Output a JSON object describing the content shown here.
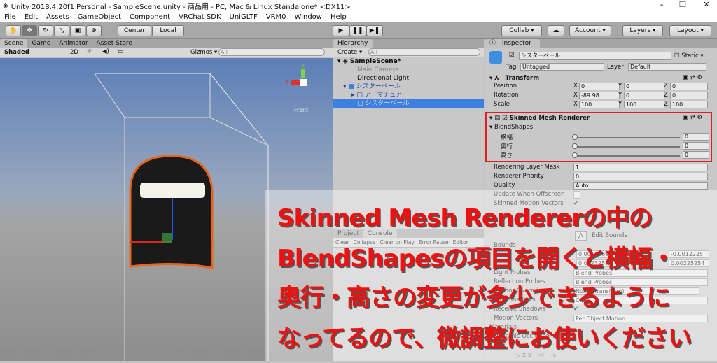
{
  "window": {
    "title": "Unity 2018.4.20f1 Personal - SampleScene.unity - 商品用 - PC, Mac & Linux Standalone* <DX11>",
    "min": "–",
    "max": "❐",
    "close": "✕"
  },
  "menu": [
    "File",
    "Edit",
    "Assets",
    "GameObject",
    "Component",
    "VRChat SDK",
    "UniGLTF",
    "VRM0",
    "Window",
    "Help"
  ],
  "toolbar": {
    "center": "Center",
    "local": "Local",
    "collab": "Collab ▾",
    "account": "Account ▾",
    "layers": "Layers ▾",
    "layout": "Layout ▾",
    "play": "▶",
    "pause": "❚❚",
    "step": "▶❚"
  },
  "scene": {
    "tabs": [
      "Scene",
      "Game",
      "Animator",
      "Asset Store"
    ],
    "shading": "Shaded",
    "mode2d": "2D",
    "gizmos": "Gizmos ▾",
    "search_placeholder": "All",
    "gizmo_label": "Front",
    "axis_x": "x",
    "axis_y": "y"
  },
  "hierarchy": {
    "tab": "Hierarchy",
    "create": "Create ▾",
    "search_placeholder": "All",
    "scene": "SampleScene*",
    "items": [
      "Main Camera",
      "Directional Light",
      "シスターベール",
      "アーマチュア",
      "シスターベール"
    ]
  },
  "console": {
    "tabs": [
      "Project",
      "Console"
    ],
    "buttons": [
      "Clear",
      "Collapse",
      "Clear on Play",
      "Error Pause",
      "Editor"
    ]
  },
  "inspector": {
    "tab": "Inspector",
    "object_name": "シスターベール",
    "static": "Static",
    "tag_label": "Tag",
    "tag": "Untagged",
    "layer_label": "Layer",
    "layer": "Default",
    "transform": {
      "title": "Transform",
      "rows": [
        {
          "label": "Position",
          "x": "0",
          "y": "0",
          "z": "0"
        },
        {
          "label": "Rotation",
          "x": "-89.98",
          "y": "0",
          "z": "0"
        },
        {
          "label": "Scale",
          "x": "100",
          "y": "100",
          "z": "100"
        }
      ]
    },
    "smr": {
      "title": "Skinned Mesh Renderer",
      "blendshapes": "BlendShapes",
      "shapes": [
        {
          "label": "横幅",
          "value": "0"
        },
        {
          "label": "奥行",
          "value": "0"
        },
        {
          "label": "高さ",
          "value": "0"
        }
      ],
      "props": [
        {
          "label": "Rendering Layer Mask",
          "value": "1"
        },
        {
          "label": "Renderer Priority",
          "value": "0"
        },
        {
          "label": "Quality",
          "value": "Auto"
        },
        {
          "label": "Update When Offscreen",
          "value": ""
        },
        {
          "label": "Skinned Motion Vectors",
          "value": "✔"
        }
      ],
      "edit_bounds": "Edit Bounds",
      "bounds": "Bounds",
      "bounds_vals": [
        "0.0015869",
        "-0.0012225",
        "0.0023257",
        "0.00225254"
      ],
      "lower": [
        {
          "label": "Light Probes",
          "value": "Blend Probes"
        },
        {
          "label": "Reflection Probes",
          "value": "Blend Probes"
        },
        {
          "label": "Anchor Override",
          "value": "None (Transform)"
        },
        {
          "label": "Cast Shadows",
          "value": "On"
        },
        {
          "label": "Receive Shadows",
          "value": "✔"
        },
        {
          "label": "Motion Vectors",
          "value": "Per Object Motion"
        },
        {
          "label": "Materials",
          "value": ""
        },
        {
          "label": "Dynamic Occluded",
          "value": ""
        }
      ],
      "material": "シスターベール"
    }
  },
  "overlay": {
    "lines": [
      "Skinned Mesh Rendererの中の",
      "BlendShapesの項目を開くと横幅・",
      "奥行・高さの変更が多少できるように",
      "なってるので、微調整にお使いください"
    ]
  },
  "colors": {
    "highlight": "#e02020",
    "selection": "#3d80df",
    "overlay_text": "#f01010"
  }
}
